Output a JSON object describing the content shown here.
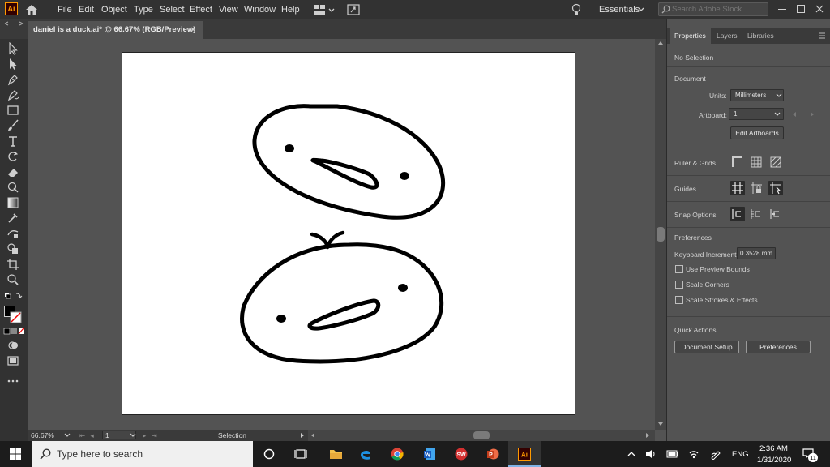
{
  "app": {
    "logo": "Ai",
    "menu": [
      "File",
      "Edit",
      "Object",
      "Type",
      "Select",
      "Effect",
      "View",
      "Window",
      "Help"
    ],
    "workspace": "Essentials",
    "search_placeholder": "Search Adobe Stock"
  },
  "document": {
    "tab_title": "daniel is a duck.ai* @ 66.67% (RGB/Preview)",
    "close": "×"
  },
  "status": {
    "zoom": "66.67%",
    "artboard": "1",
    "tool": "Selection"
  },
  "panel": {
    "tabs": [
      "Properties",
      "Layers",
      "Libraries"
    ],
    "selection": "No Selection",
    "document_heading": "Document",
    "units_label": "Units:",
    "units_value": "Millimeters",
    "artboard_label": "Artboard:",
    "artboard_value": "1",
    "edit_artboards": "Edit Artboards",
    "ruler_grids": "Ruler & Grids",
    "guides": "Guides",
    "snap_options": "Snap Options",
    "preferences_heading": "Preferences",
    "keyboard_increment_label": "Keyboard Increment:",
    "keyboard_increment_value": "0.3528 mm",
    "checkboxes": [
      "Use Preview Bounds",
      "Scale Corners",
      "Scale Strokes & Effects"
    ],
    "quick_actions": "Quick Actions",
    "document_setup": "Document Setup",
    "preferences_button": "Preferences"
  },
  "taskbar": {
    "search_placeholder": "Type here to search",
    "language": "ENG",
    "time": "2:36 AM",
    "date": "1/31/2020",
    "notification_count": "11"
  },
  "colors": {
    "ai_orange": "#ff9a00",
    "panel_bg": "#535353",
    "chrome_dark": "#323232"
  }
}
